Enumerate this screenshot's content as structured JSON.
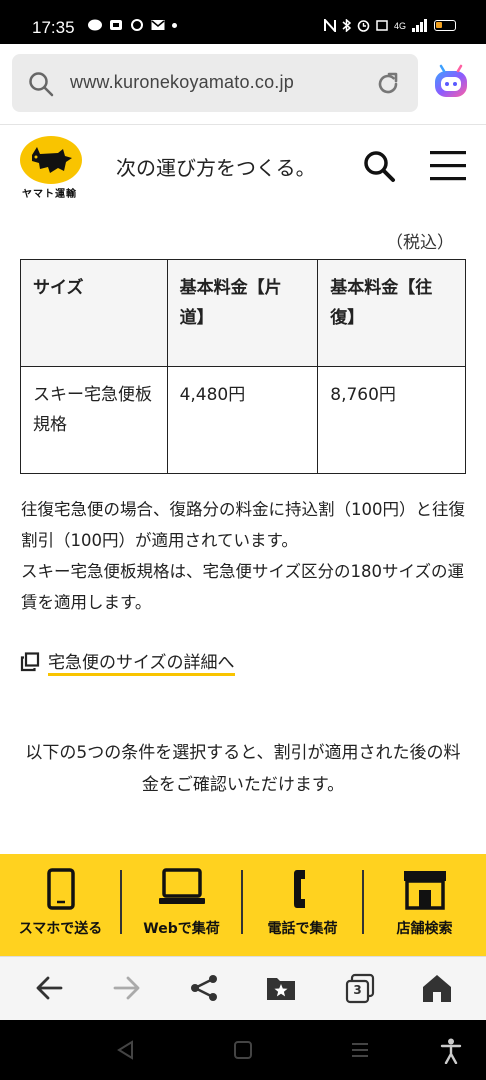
{
  "status_bar": {
    "time": "17:35",
    "network": "4G"
  },
  "browser": {
    "url": "www.kuronekoyamato.co.jp"
  },
  "header": {
    "logo_text": "ヤマト運輸",
    "tagline": "次の運び方をつくる。"
  },
  "content": {
    "tax_note": "（税込）",
    "table": {
      "headers": [
        "サイズ",
        "基本料金【片道】",
        "基本料金【往復】"
      ],
      "rows": [
        [
          "スキー宅急便板規格",
          "4,480円",
          "8,760円"
        ]
      ]
    },
    "note_lines": [
      "往復宅急便の場合、復路分の料金に持込割（100円）と往復割引（100円）が適用されています。",
      "スキー宅急便板規格は、宅急便サイズ区分の180サイズの運賃を適用します。"
    ],
    "size_link": "宅急便のサイズの詳細へ",
    "conditions_text": "以下の5つの条件を選択すると、割引が適用された後の料金をご確認いただけます。"
  },
  "action_bar": {
    "items": [
      {
        "label": "スマホで送る",
        "icon": "smartphone-icon"
      },
      {
        "label": "Webで集荷",
        "icon": "laptop-icon"
      },
      {
        "label": "電話で集荷",
        "icon": "phone-icon"
      },
      {
        "label": "店舗検索",
        "icon": "store-icon"
      }
    ]
  },
  "browser_nav": {
    "tab_count": "3"
  },
  "colors": {
    "brand_yellow": "#ffd21f",
    "logo_yellow": "#f9c400"
  }
}
